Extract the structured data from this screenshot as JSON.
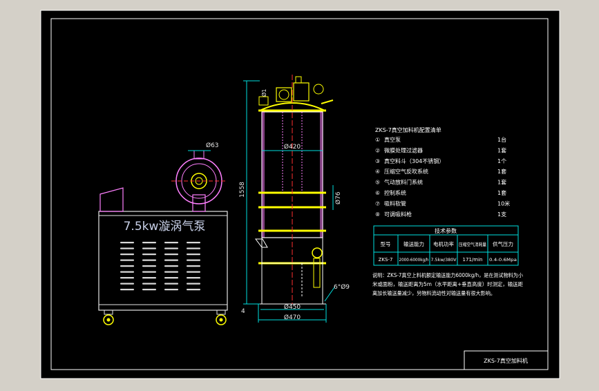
{
  "colors": {
    "background": "#d4d0c8",
    "sheet": "#000000",
    "border": "#ffffff",
    "pump_lines": "#e6e6e6",
    "pump_label": "#c8d0e8",
    "body_outline": "#ffffff",
    "flange": "#ffff00",
    "body_fill": "#ff80ff",
    "centerline": "#ff3030",
    "dimension": "#00e0e0",
    "table_text": "#ffffff",
    "table_lines": "#00e0e0",
    "logo_red": "#ff6060",
    "wheel": "#ffff00"
  },
  "pump": {
    "label": "7.5kw漩涡气泵",
    "dim_outlet": "Ø63"
  },
  "vessel": {
    "dim_diameter": "Ø420",
    "dim_height": "1558",
    "dim_side": "Ø76",
    "dim_top": "Ø1",
    "dim_holes": "6°Ø9",
    "dim_bottom_inner": "Ø450",
    "dim_bottom_outer": "Ø470",
    "dim_leg": "4"
  },
  "config_list": {
    "title": "ZKS-7真空加料机配置清单",
    "items": [
      {
        "no": "①",
        "name": "真空泵",
        "qty": "1台"
      },
      {
        "no": "②",
        "name": "微膜处理过滤器",
        "qty": "1套"
      },
      {
        "no": "③",
        "name": "真空料斗（304不锈钢）",
        "qty": "1个"
      },
      {
        "no": "④",
        "name": "压缩空气反吹系统",
        "qty": "1套"
      },
      {
        "no": "⑤",
        "name": "气动放料门系统",
        "qty": "1套"
      },
      {
        "no": "⑥",
        "name": "控制系统",
        "qty": "1套"
      },
      {
        "no": "⑦",
        "name": "吸料软管",
        "qty": "10米"
      },
      {
        "no": "⑧",
        "name": "可调吸料枪",
        "qty": "1支"
      }
    ]
  },
  "tech_table": {
    "title": "技术参数",
    "headers": [
      "型号",
      "输送能力",
      "电机功率",
      "压缩空气消耗量",
      "供气压力"
    ],
    "row": [
      "ZKS-7",
      "2000-6000kg/h",
      "7.5kw/380V",
      "171/min",
      "0.4-0.6Mpa"
    ]
  },
  "note": {
    "lines": [
      "说明：ZKS-7真空上料机额定输送能力6000kg/h，是在测试物料为小",
      "米或面粉，输送距离为5m（水平距离+垂直高度）时测定，输送距",
      "离加长输送量减少，另物料流动性对输送量有很大影响。"
    ]
  },
  "title_block": {
    "title": "ZKS-7真空加料机"
  }
}
